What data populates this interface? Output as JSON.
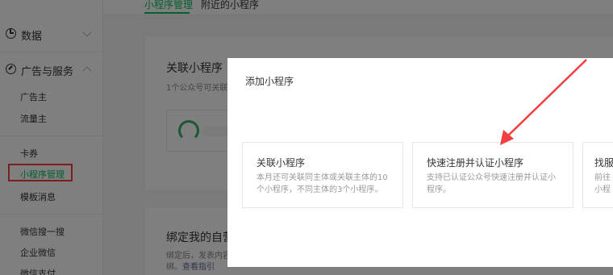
{
  "sidebar": {
    "data_group": "数据",
    "ads_group": "广告与服务",
    "items": [
      "广告主",
      "流量主",
      "卡券",
      "小程序管理",
      "模板消息",
      "微信搜一搜",
      "企业微信",
      "微信支付"
    ]
  },
  "tabs": [
    "小程序管理",
    "附近的小程序"
  ],
  "card1": {
    "title": "关联小程序",
    "subtitle": "1个公众号可关联1"
  },
  "card2": {
    "title": "绑定我的自营",
    "desc_prefix": "绑定后，发表内容",
    "desc_line2": "绑。",
    "link": "查看指引"
  },
  "dialog": {
    "title": "添加小程序",
    "options": [
      {
        "title": "关联小程序",
        "desc": "本月还可关联同主体或关联主体的10个小程序，不同主体的3个小程序。"
      },
      {
        "title": "快速注册并认证小程序",
        "desc": "支持已认证公众号快速注册并认证小程序。"
      },
      {
        "title": "找服",
        "desc_line1": "前往",
        "desc_line2": "小程"
      }
    ]
  },
  "colors": {
    "accent": "#07c160",
    "highlight": "#f43f3f",
    "link": "#576b95"
  }
}
